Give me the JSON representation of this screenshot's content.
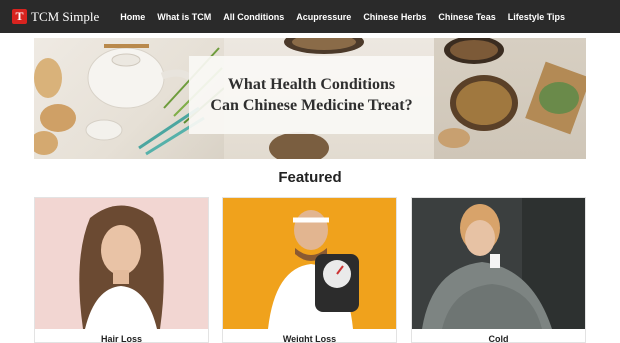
{
  "site": {
    "logo_letter": "T",
    "logo_text": "TCM Simple"
  },
  "nav": {
    "items": [
      {
        "label": "Home"
      },
      {
        "label": "What is TCM"
      },
      {
        "label": "All Conditions"
      },
      {
        "label": "Acupressure"
      },
      {
        "label": "Chinese Herbs"
      },
      {
        "label": "Chinese Teas"
      },
      {
        "label": "Lifestyle Tips"
      }
    ]
  },
  "hero": {
    "line1": "What Health Conditions",
    "line2": "Can Chinese Medicine Treat?"
  },
  "featured": {
    "title": "Featured",
    "cards": [
      {
        "label": "Hair Loss"
      },
      {
        "label": "Weight Loss"
      },
      {
        "label": "Cold"
      }
    ]
  },
  "colors": {
    "nav_bg": "#2a2a2a",
    "logo_red": "#d8231f",
    "card2_bg": "#f0a21c"
  }
}
